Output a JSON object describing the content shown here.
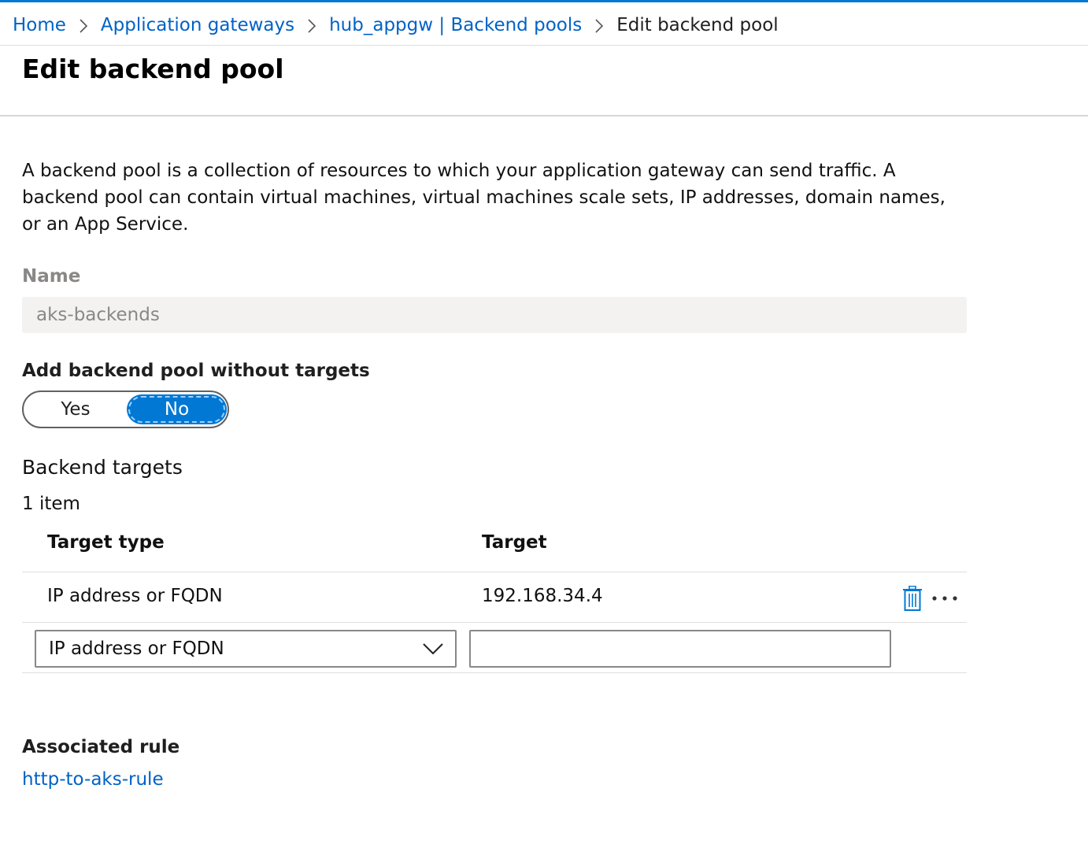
{
  "breadcrumb": {
    "items": [
      {
        "label": "Home"
      },
      {
        "label": "Application gateways"
      },
      {
        "label": "hub_appgw | Backend pools"
      }
    ],
    "current": "Edit backend pool"
  },
  "page": {
    "title": "Edit backend pool",
    "description": "A backend pool is a collection of resources to which your application gateway can send traffic. A backend pool can contain virtual machines, virtual machines scale sets, IP addresses, domain names, or an App Service."
  },
  "name_field": {
    "label": "Name",
    "value": "aks-backends"
  },
  "without_targets": {
    "label": "Add backend pool without targets",
    "options": [
      "Yes",
      "No"
    ],
    "selected": "No"
  },
  "backend_targets": {
    "title": "Backend targets",
    "count_text": "1 item",
    "columns": [
      "Target type",
      "Target"
    ],
    "rows": [
      {
        "type": "IP address or FQDN",
        "target": "192.168.34.4"
      }
    ],
    "new_row": {
      "type_value": "IP address or FQDN",
      "target_value": "",
      "target_placeholder": ""
    }
  },
  "associated_rule": {
    "label": "Associated rule",
    "link": "http-to-aks-rule"
  },
  "colors": {
    "accent": "#0078d4",
    "link": "#0062c6",
    "disabled_text": "#8a8886",
    "disabled_bg": "#f3f2f1"
  },
  "icons": {
    "breadcrumb_separator": "chevron-right-icon",
    "delete": "trash-icon",
    "more": "more-icon",
    "dropdown": "chevron-down-icon"
  }
}
